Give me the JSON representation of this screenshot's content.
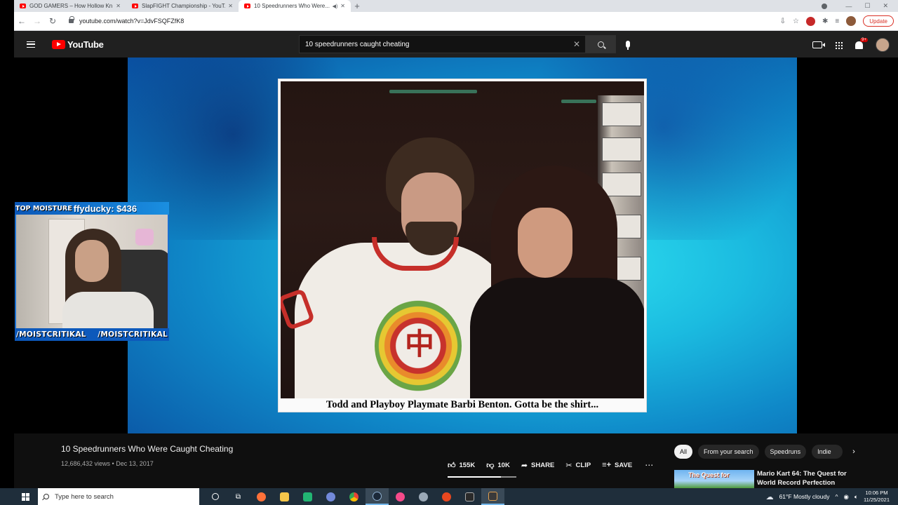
{
  "browser": {
    "tabs": [
      {
        "title": "GOD GAMERS – How Hollow Kn...",
        "active": false
      },
      {
        "title": "SlapFIGHT Championship - YouT...",
        "active": false
      },
      {
        "title": "10 Speedrunners Who Were...",
        "active": true
      }
    ],
    "url": "youtube.com/watch?v=JdvFSQFZfK8",
    "update_label": "Update"
  },
  "youtube": {
    "logo_text": "YouTube",
    "search_value": "10 speedrunners caught cheating",
    "notif_count": "9+",
    "video_caption": "Todd and Playboy Playmate Barbi Benton.  Gotta be the shirt...",
    "video_title": "10 Speedrunners Who Were Caught Cheating",
    "video_meta": "12,686,432 views • Dec 13, 2017",
    "actions": {
      "likes": "155K",
      "dislikes": "10K",
      "share": "SHARE",
      "clip": "CLIP",
      "save": "SAVE"
    },
    "like_ratio": 0.78,
    "chips": [
      "All",
      "From your search",
      "Speedruns",
      "Indie"
    ],
    "recommended": {
      "title": "Mario Kart 64: The Quest for World Record Perfection",
      "thumb_text": "The Quest for"
    }
  },
  "stream_overlay": {
    "top_label": "TOP MOISTURE",
    "ticker": "ffyducky: $436",
    "bottom_left": "/MOISTCRITIKAL",
    "bottom_right": "/MOISTCRITIKAL"
  },
  "taskbar": {
    "search_placeholder": "Type here to search",
    "weather": "61°F  Mostly cloudy",
    "time": "10:06 PM",
    "date": "11/25/2021"
  },
  "colors": {
    "youtube_red": "#ff0000",
    "stream_blue": "#0d59bb",
    "taskbar": "#1f2e3b"
  }
}
